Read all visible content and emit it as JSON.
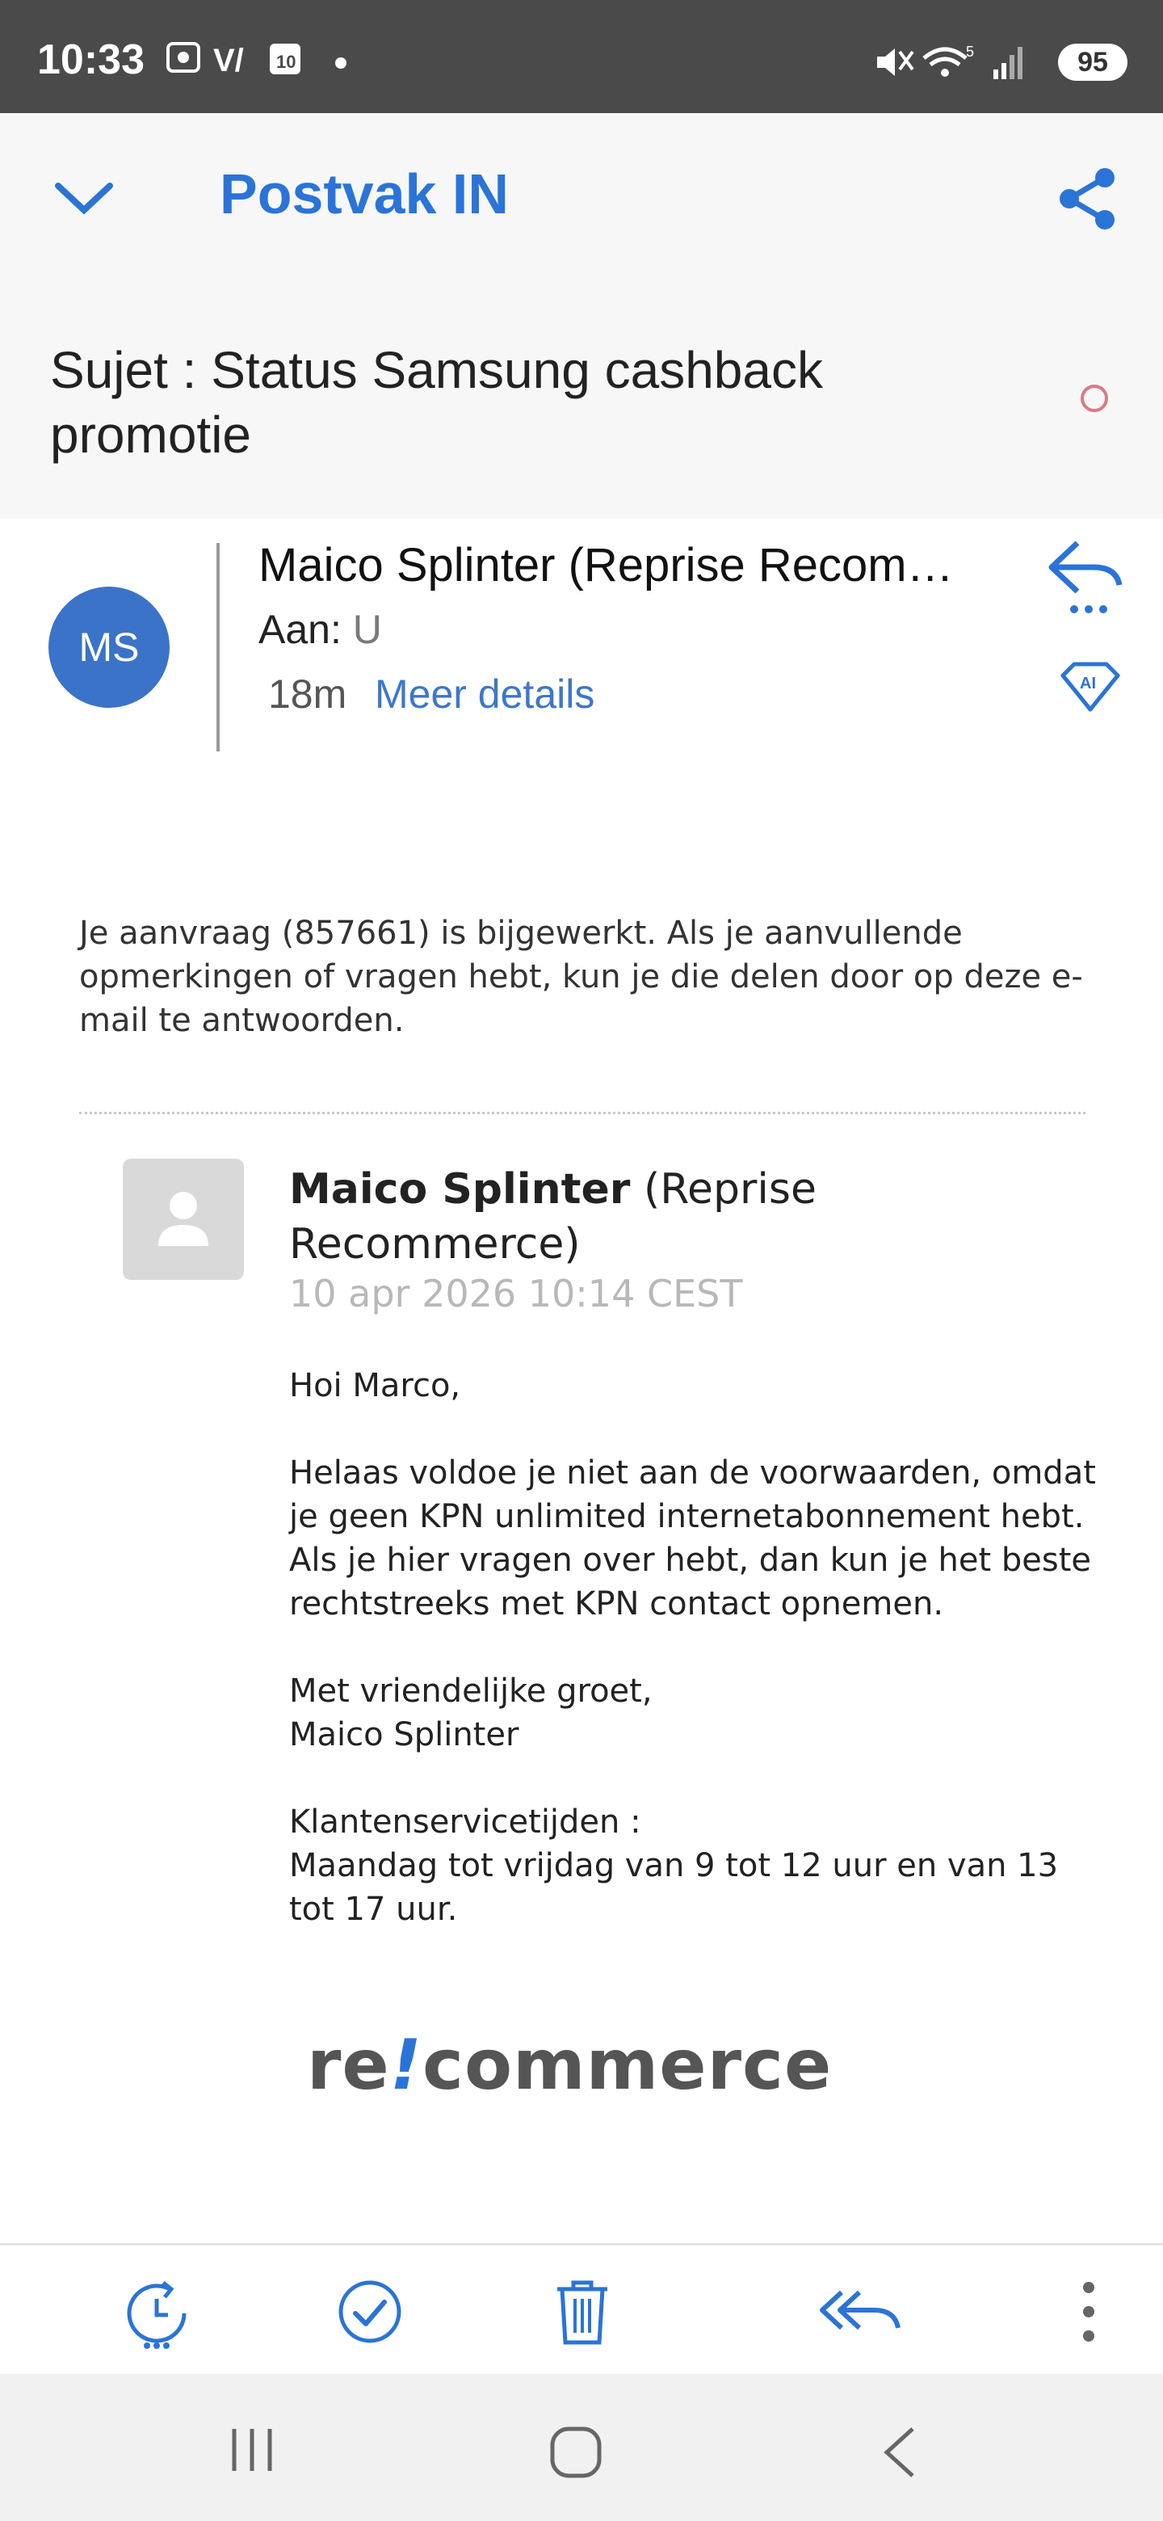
{
  "status": {
    "time": "10:33",
    "battery": "95"
  },
  "header": {
    "folder": "Postvak IN",
    "subject": "Sujet : Status Samsung cashback promotie"
  },
  "sender": {
    "initials": "MS",
    "name": "Maico Splinter (Reprise Recom…",
    "to_label": "Aan:",
    "to_value": "U",
    "time_ago": "18m",
    "more_details": "Meer details"
  },
  "body": {
    "intro": "Je aanvraag (857661) is bijgewerkt. Als je aanvullende opmerkingen of vragen hebt, kun je die delen door op deze e-mail te antwoorden.",
    "quoted": {
      "name_bold": "Maico Splinter",
      "name_rest": "(Reprise Recommerce)",
      "date": "10 apr 2026 10:14 CEST",
      "greeting": "Hoi Marco,",
      "paragraph": "Helaas voldoe je niet aan de voorwaarden, omdat je geen KPN unlimited internetabonnement hebt. Als je hier vragen over hebt, dan kun je het beste rechtstreeks met KPN contact opnemen.",
      "closing_1": "Met vriendelijke groet,",
      "closing_2": "Maico Splinter",
      "hours_title": "Klantenservicetijden :",
      "hours_text": "Maandag tot vrijdag van 9 tot 12 uur en van 13 tot 17 uur."
    },
    "logo": {
      "part1": "re",
      "part2": "!",
      "part3": "commerce"
    }
  },
  "colors": {
    "accent": "#2a74d8",
    "avatar": "#3b73c9",
    "status_bar": "#4a4a4a"
  },
  "icons": [
    "chevron-down-icon",
    "share-icon",
    "reply-icon",
    "ai-icon",
    "snooze-icon",
    "check-icon",
    "trash-icon",
    "reply-all-icon",
    "more-vertical-icon"
  ]
}
